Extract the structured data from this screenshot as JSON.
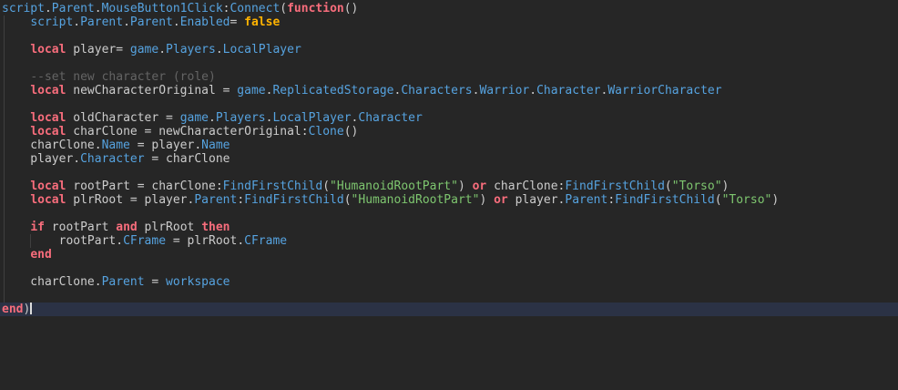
{
  "editor": {
    "type": "lua-script-editor",
    "colors": {
      "background": "#262626",
      "current_line_background": "#2b3245",
      "plain_text": "#cccccc",
      "keyword": "#f86d7c",
      "builtin_or_property": "#56a3e0",
      "string": "#7ec66f",
      "comment": "#646464",
      "boolean": "#ffb300",
      "cursor": "#dcdcdc",
      "indent_guide": "#3f3f3f"
    },
    "token_types": {
      "d": "plain",
      "k": "keyword",
      "p": "builtin-or-property",
      "s": "string",
      "c": "comment",
      "b": "boolean"
    },
    "current_line_index": 22,
    "cursor_line_index": 22,
    "lines": [
      [
        [
          "p",
          "script"
        ],
        [
          "d",
          "."
        ],
        [
          "p",
          "Parent"
        ],
        [
          "d",
          "."
        ],
        [
          "p",
          "MouseButton1Click"
        ],
        [
          "d",
          ":"
        ],
        [
          "p",
          "Connect"
        ],
        [
          "d",
          "("
        ],
        [
          "k",
          "function"
        ],
        [
          "d",
          "()"
        ]
      ],
      [
        [
          "d",
          "    "
        ],
        [
          "p",
          "script"
        ],
        [
          "d",
          "."
        ],
        [
          "p",
          "Parent"
        ],
        [
          "d",
          "."
        ],
        [
          "p",
          "Parent"
        ],
        [
          "d",
          "."
        ],
        [
          "p",
          "Enabled"
        ],
        [
          "d",
          "= "
        ],
        [
          "b",
          "false"
        ]
      ],
      [],
      [
        [
          "d",
          "    "
        ],
        [
          "k",
          "local"
        ],
        [
          "d",
          " player= "
        ],
        [
          "p",
          "game"
        ],
        [
          "d",
          "."
        ],
        [
          "p",
          "Players"
        ],
        [
          "d",
          "."
        ],
        [
          "p",
          "LocalPlayer"
        ]
      ],
      [],
      [
        [
          "d",
          "    "
        ],
        [
          "c",
          "--set new character (role)"
        ]
      ],
      [
        [
          "d",
          "    "
        ],
        [
          "k",
          "local"
        ],
        [
          "d",
          " newCharacterOriginal = "
        ],
        [
          "p",
          "game"
        ],
        [
          "d",
          "."
        ],
        [
          "p",
          "ReplicatedStorage"
        ],
        [
          "d",
          "."
        ],
        [
          "p",
          "Characters"
        ],
        [
          "d",
          "."
        ],
        [
          "p",
          "Warrior"
        ],
        [
          "d",
          "."
        ],
        [
          "p",
          "Character"
        ],
        [
          "d",
          "."
        ],
        [
          "p",
          "WarriorCharacter"
        ]
      ],
      [],
      [
        [
          "d",
          "    "
        ],
        [
          "k",
          "local"
        ],
        [
          "d",
          " oldCharacter = "
        ],
        [
          "p",
          "game"
        ],
        [
          "d",
          "."
        ],
        [
          "p",
          "Players"
        ],
        [
          "d",
          "."
        ],
        [
          "p",
          "LocalPlayer"
        ],
        [
          "d",
          "."
        ],
        [
          "p",
          "Character"
        ]
      ],
      [
        [
          "d",
          "    "
        ],
        [
          "k",
          "local"
        ],
        [
          "d",
          " charClone = newCharacterOriginal:"
        ],
        [
          "p",
          "Clone"
        ],
        [
          "d",
          "()"
        ]
      ],
      [
        [
          "d",
          "    charClone"
        ],
        [
          "d",
          "."
        ],
        [
          "p",
          "Name"
        ],
        [
          "d",
          " = player"
        ],
        [
          "d",
          "."
        ],
        [
          "p",
          "Name"
        ]
      ],
      [
        [
          "d",
          "    player"
        ],
        [
          "d",
          "."
        ],
        [
          "p",
          "Character"
        ],
        [
          "d",
          " = charClone"
        ]
      ],
      [],
      [
        [
          "d",
          "    "
        ],
        [
          "k",
          "local"
        ],
        [
          "d",
          " rootPart = charClone:"
        ],
        [
          "p",
          "FindFirstChild"
        ],
        [
          "d",
          "("
        ],
        [
          "s",
          "\"HumanoidRootPart\""
        ],
        [
          "d",
          ") "
        ],
        [
          "k",
          "or"
        ],
        [
          "d",
          " charClone:"
        ],
        [
          "p",
          "FindFirstChild"
        ],
        [
          "d",
          "("
        ],
        [
          "s",
          "\"Torso\""
        ],
        [
          "d",
          ")"
        ]
      ],
      [
        [
          "d",
          "    "
        ],
        [
          "k",
          "local"
        ],
        [
          "d",
          " plrRoot = player"
        ],
        [
          "d",
          "."
        ],
        [
          "p",
          "Parent"
        ],
        [
          "d",
          ":"
        ],
        [
          "p",
          "FindFirstChild"
        ],
        [
          "d",
          "("
        ],
        [
          "s",
          "\"HumanoidRootPart\""
        ],
        [
          "d",
          ") "
        ],
        [
          "k",
          "or"
        ],
        [
          "d",
          " player"
        ],
        [
          "d",
          "."
        ],
        [
          "p",
          "Parent"
        ],
        [
          "d",
          ":"
        ],
        [
          "p",
          "FindFirstChild"
        ],
        [
          "d",
          "("
        ],
        [
          "s",
          "\"Torso\""
        ],
        [
          "d",
          ")"
        ]
      ],
      [],
      [
        [
          "d",
          "    "
        ],
        [
          "k",
          "if"
        ],
        [
          "d",
          " rootPart "
        ],
        [
          "k",
          "and"
        ],
        [
          "d",
          " plrRoot "
        ],
        [
          "k",
          "then"
        ]
      ],
      [
        [
          "d",
          "        rootPart"
        ],
        [
          "d",
          "."
        ],
        [
          "p",
          "CFrame"
        ],
        [
          "d",
          " = plrRoot"
        ],
        [
          "d",
          "."
        ],
        [
          "p",
          "CFrame"
        ]
      ],
      [
        [
          "d",
          "    "
        ],
        [
          "k",
          "end"
        ]
      ],
      [],
      [
        [
          "d",
          "    charClone"
        ],
        [
          "d",
          "."
        ],
        [
          "p",
          "Parent"
        ],
        [
          "d",
          " = "
        ],
        [
          "p",
          "workspace"
        ]
      ],
      [],
      [
        [
          "k",
          "end"
        ],
        [
          "d",
          ")"
        ]
      ]
    ]
  }
}
